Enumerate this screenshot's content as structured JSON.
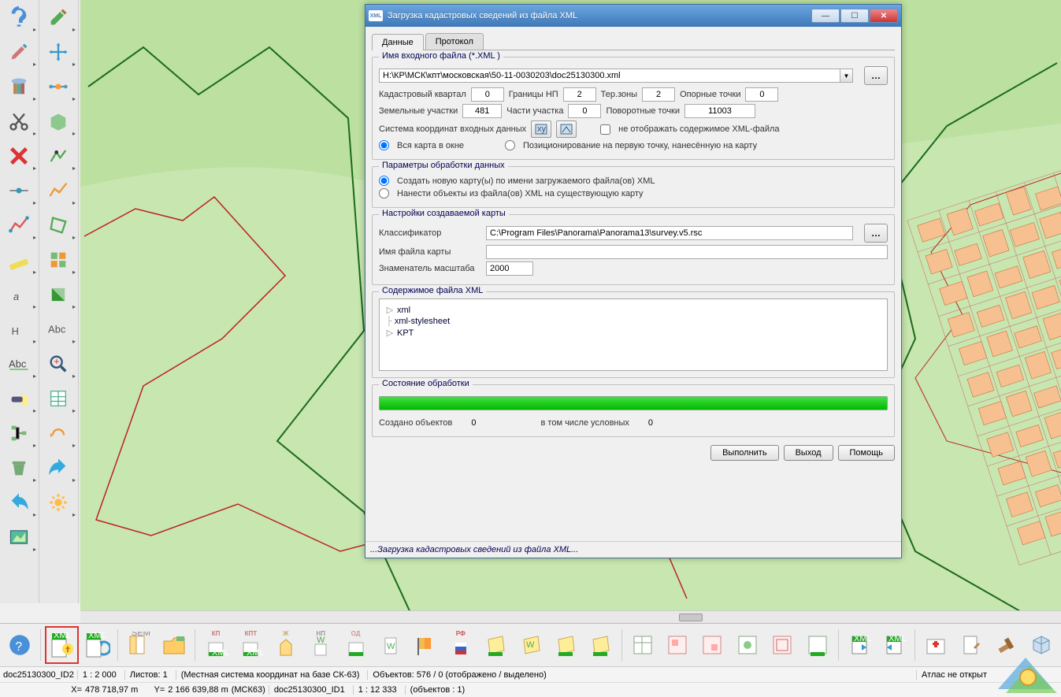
{
  "dialog": {
    "title": "Загрузка кадастровых сведений из файла XML",
    "tabs": {
      "data": "Данные",
      "protocol": "Протокол"
    },
    "input_group": "Имя входного файла (*.XML )",
    "input_path": "H:\\КР\\МСК\\кпт\\московская\\50-11-0030203\\doc25130300.xml",
    "labels": {
      "kvartal": "Кадастровый квартал",
      "gnp": "Границы НП",
      "terzony": "Тер.зоны",
      "opornye": "Опорные точки",
      "zem": "Земельные участки",
      "chasti": "Части участка",
      "povor": "Поворотные точки",
      "sk": "Система координат входных данных",
      "hide_xml": "не отображать содержимое XML-файла",
      "whole_map": "Вся карта в окне",
      "pos_first": "Позиционирование на первую точку, нанесённую на  карту",
      "params": "Параметры обработки данных",
      "create_new": "Создать новую карту(ы) по имени загружаемого файла(ов) XML",
      "apply_existing": "Нанести объекты из файла(ов) XML на существующую карту",
      "map_settings": "Настройки создаваемой карты",
      "classifier": "Классификатор",
      "map_file": "Имя файла карты",
      "scale": "Знаменатель масштаба",
      "xml_content": "Содержимое файла XML",
      "proc_state": "Состояние обработки",
      "created": "Создано объектов",
      "conditional": "в том числе условных"
    },
    "values": {
      "kvartal": "0",
      "gnp": "2",
      "terzony": "2",
      "opornye": "0",
      "zem": "481",
      "chasti": "0",
      "povor": "11003",
      "classifier_path": "C:\\Program Files\\Panorama\\Panorama13\\survey.v5.rsc",
      "scale": "2000",
      "created": "0",
      "conditional": "0"
    },
    "tree": {
      "n1": "xml",
      "n2": "xml-stylesheet",
      "n3": "KPT"
    },
    "buttons": {
      "run": "Выполнить",
      "exit": "Выход",
      "help": "Помощь"
    },
    "status": "...Загрузка кадастровых сведений из файла XML..."
  },
  "statusbar": {
    "doc": "doc25130300_ID2",
    "scale": "1 : 2 000",
    "sheets": "Листов: 1",
    "crs": "(Местная система координат на базе СК-63)",
    "objects": "Объектов: 576 / 0 (отображено / выделено)",
    "x_lbl": "X=",
    "x": "478 718,97 m",
    "y_lbl": "Y=",
    "y": "2 166 639,88 m",
    "msk": "(МСК63)",
    "doc2": "doc25130300_ID1",
    "scale2": "1 : 12 333",
    "objects2": "(объектов : 1)",
    "atlas": "Атлас не открыт"
  },
  "bottom_caps": {
    "xml1": "XML",
    "xml2": "XML",
    "sem": "SEM",
    "kp": "КП",
    "kpt": "КПТ",
    "zh": "Ж",
    "np": "НП",
    "od": "ОД",
    "rf": "РФ"
  }
}
